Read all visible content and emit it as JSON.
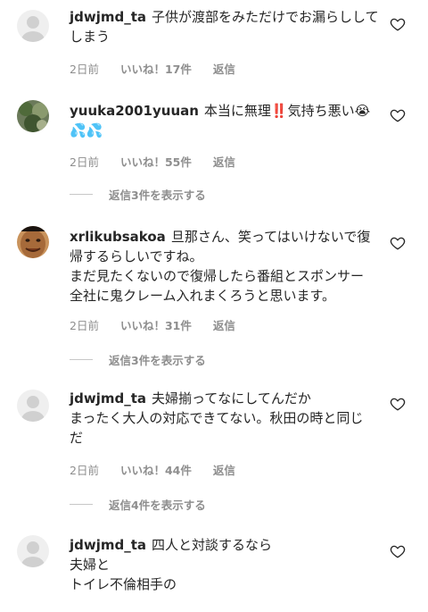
{
  "comments": [
    {
      "username": "jdwjmd_ta",
      "text_lines": [
        "子供が渡部をみただけでお漏らしして",
        "しまう"
      ],
      "time": "2日前",
      "likes": "いいね！17件",
      "reply": "返信",
      "avatar": "default-avatar"
    },
    {
      "username": "yuuka2001yuuan",
      "text_lines": [
        "本当に無理‼️気持ち悪い😭",
        "💦💦"
      ],
      "time": "2日前",
      "likes": "いいね！55件",
      "reply": "返信",
      "view_replies": "返信3件を表示する",
      "avatar": "photo-avatar-green"
    },
    {
      "username": "xrlikubsakoa",
      "text_lines": [
        "旦那さん、笑ってはいけないで復",
        "帰するらしいですね。",
        "まだ見たくないので復帰したら番組とスポンサー",
        "全社に鬼クレーム入れまくろうと思います。"
      ],
      "time": "2日前",
      "likes": "いいね！31件",
      "reply": "返信",
      "view_replies": "返信3件を表示する",
      "avatar": "photo-avatar-face"
    },
    {
      "username": "jdwjmd_ta",
      "text_lines": [
        "夫婦揃ってなにしてんだか",
        "まったく大人の対応できてない。秋田の時と同じ",
        "だ"
      ],
      "time": "2日前",
      "likes": "いいね！44件",
      "reply": "返信",
      "view_replies": "返信4件を表示する",
      "avatar": "default-avatar"
    },
    {
      "username": "jdwjmd_ta",
      "text_lines": [
        "四人と対談するなら",
        "夫婦と",
        "トイレ不倫相手の"
      ],
      "avatar": "default-avatar"
    }
  ],
  "colors": {
    "text": "#262626",
    "muted": "#8e8e8e",
    "avatar_default": "#dbdbdb"
  }
}
